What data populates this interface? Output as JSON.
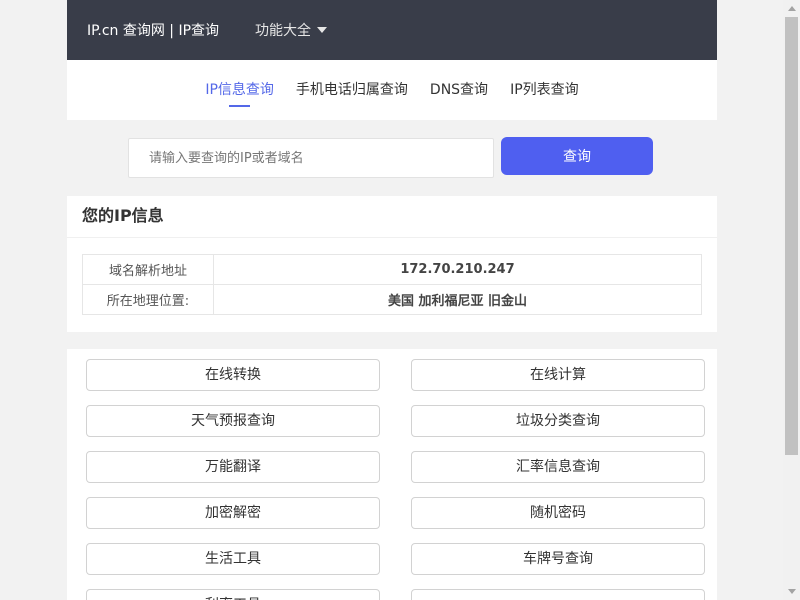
{
  "header": {
    "brand": "IP.cn 查询网 | IP查询",
    "menu_label": "功能大全"
  },
  "tabs": [
    {
      "label": "IP信息查询",
      "active": true
    },
    {
      "label": "手机电话归属查询",
      "active": false
    },
    {
      "label": "DNS查询",
      "active": false
    },
    {
      "label": "IP列表查询",
      "active": false
    }
  ],
  "search": {
    "placeholder": "请输入要查询的IP或者域名",
    "value": "",
    "button_label": "查询"
  },
  "ip_info": {
    "title": "您的IP信息",
    "rows": [
      {
        "key": "域名解析地址",
        "value": "172.70.210.247"
      },
      {
        "key": "所在地理位置:",
        "value": "美国 加利福尼亚 旧金山"
      }
    ]
  },
  "tools": [
    "在线转换",
    "在线计算",
    "天气预报查询",
    "垃圾分类查询",
    "万能翻译",
    "汇率信息查询",
    "加密解密",
    "随机密码",
    "生活工具",
    "车牌号查询",
    "利率工具"
  ],
  "colors": {
    "topbar": "#393d49",
    "accent": "#4f5ff0",
    "active_tab": "#5468e8",
    "background": "#f2f2f2"
  },
  "icons": {
    "menu_caret": "caret-down-icon",
    "scroll_up": "arrow-up-icon",
    "scroll_down": "arrow-down-icon"
  }
}
